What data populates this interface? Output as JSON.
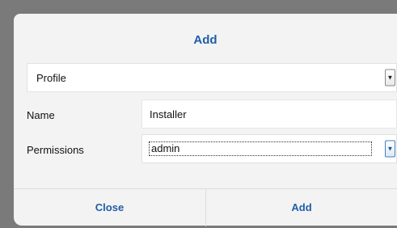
{
  "dialog": {
    "title": "Add",
    "profile_select": {
      "value": "Profile",
      "caret": "▼"
    },
    "name": {
      "label": "Name",
      "value": "Installer"
    },
    "permissions": {
      "label": "Permissions",
      "value": "admin",
      "caret": "▼"
    },
    "buttons": {
      "close": "Close",
      "add": "Add"
    },
    "colors": {
      "accent": "#1f5ea8",
      "background": "#f3f3f3",
      "overlay": "#7a7a7a"
    }
  }
}
